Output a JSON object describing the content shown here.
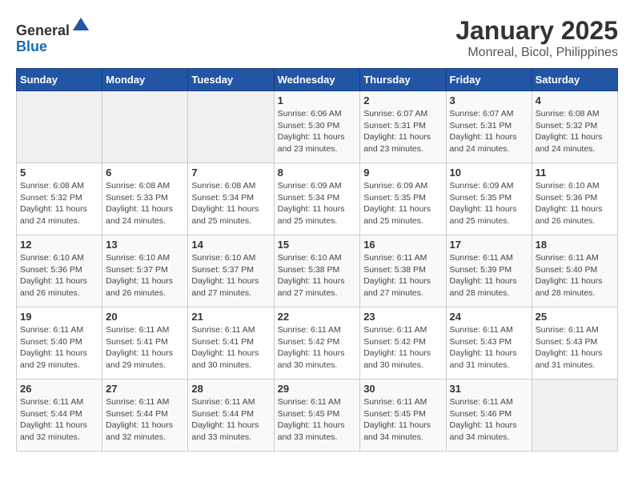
{
  "header": {
    "logo_line1": "General",
    "logo_line2": "Blue",
    "title": "January 2025",
    "subtitle": "Monreal, Bicol, Philippines"
  },
  "days_of_week": [
    "Sunday",
    "Monday",
    "Tuesday",
    "Wednesday",
    "Thursday",
    "Friday",
    "Saturday"
  ],
  "weeks": [
    [
      {
        "day": "",
        "info": ""
      },
      {
        "day": "",
        "info": ""
      },
      {
        "day": "",
        "info": ""
      },
      {
        "day": "1",
        "info": "Sunrise: 6:06 AM\nSunset: 5:30 PM\nDaylight: 11 hours\nand 23 minutes."
      },
      {
        "day": "2",
        "info": "Sunrise: 6:07 AM\nSunset: 5:31 PM\nDaylight: 11 hours\nand 23 minutes."
      },
      {
        "day": "3",
        "info": "Sunrise: 6:07 AM\nSunset: 5:31 PM\nDaylight: 11 hours\nand 24 minutes."
      },
      {
        "day": "4",
        "info": "Sunrise: 6:08 AM\nSunset: 5:32 PM\nDaylight: 11 hours\nand 24 minutes."
      }
    ],
    [
      {
        "day": "5",
        "info": "Sunrise: 6:08 AM\nSunset: 5:32 PM\nDaylight: 11 hours\nand 24 minutes."
      },
      {
        "day": "6",
        "info": "Sunrise: 6:08 AM\nSunset: 5:33 PM\nDaylight: 11 hours\nand 24 minutes."
      },
      {
        "day": "7",
        "info": "Sunrise: 6:08 AM\nSunset: 5:34 PM\nDaylight: 11 hours\nand 25 minutes."
      },
      {
        "day": "8",
        "info": "Sunrise: 6:09 AM\nSunset: 5:34 PM\nDaylight: 11 hours\nand 25 minutes."
      },
      {
        "day": "9",
        "info": "Sunrise: 6:09 AM\nSunset: 5:35 PM\nDaylight: 11 hours\nand 25 minutes."
      },
      {
        "day": "10",
        "info": "Sunrise: 6:09 AM\nSunset: 5:35 PM\nDaylight: 11 hours\nand 25 minutes."
      },
      {
        "day": "11",
        "info": "Sunrise: 6:10 AM\nSunset: 5:36 PM\nDaylight: 11 hours\nand 26 minutes."
      }
    ],
    [
      {
        "day": "12",
        "info": "Sunrise: 6:10 AM\nSunset: 5:36 PM\nDaylight: 11 hours\nand 26 minutes."
      },
      {
        "day": "13",
        "info": "Sunrise: 6:10 AM\nSunset: 5:37 PM\nDaylight: 11 hours\nand 26 minutes."
      },
      {
        "day": "14",
        "info": "Sunrise: 6:10 AM\nSunset: 5:37 PM\nDaylight: 11 hours\nand 27 minutes."
      },
      {
        "day": "15",
        "info": "Sunrise: 6:10 AM\nSunset: 5:38 PM\nDaylight: 11 hours\nand 27 minutes."
      },
      {
        "day": "16",
        "info": "Sunrise: 6:11 AM\nSunset: 5:38 PM\nDaylight: 11 hours\nand 27 minutes."
      },
      {
        "day": "17",
        "info": "Sunrise: 6:11 AM\nSunset: 5:39 PM\nDaylight: 11 hours\nand 28 minutes."
      },
      {
        "day": "18",
        "info": "Sunrise: 6:11 AM\nSunset: 5:40 PM\nDaylight: 11 hours\nand 28 minutes."
      }
    ],
    [
      {
        "day": "19",
        "info": "Sunrise: 6:11 AM\nSunset: 5:40 PM\nDaylight: 11 hours\nand 29 minutes."
      },
      {
        "day": "20",
        "info": "Sunrise: 6:11 AM\nSunset: 5:41 PM\nDaylight: 11 hours\nand 29 minutes."
      },
      {
        "day": "21",
        "info": "Sunrise: 6:11 AM\nSunset: 5:41 PM\nDaylight: 11 hours\nand 30 minutes."
      },
      {
        "day": "22",
        "info": "Sunrise: 6:11 AM\nSunset: 5:42 PM\nDaylight: 11 hours\nand 30 minutes."
      },
      {
        "day": "23",
        "info": "Sunrise: 6:11 AM\nSunset: 5:42 PM\nDaylight: 11 hours\nand 30 minutes."
      },
      {
        "day": "24",
        "info": "Sunrise: 6:11 AM\nSunset: 5:43 PM\nDaylight: 11 hours\nand 31 minutes."
      },
      {
        "day": "25",
        "info": "Sunrise: 6:11 AM\nSunset: 5:43 PM\nDaylight: 11 hours\nand 31 minutes."
      }
    ],
    [
      {
        "day": "26",
        "info": "Sunrise: 6:11 AM\nSunset: 5:44 PM\nDaylight: 11 hours\nand 32 minutes."
      },
      {
        "day": "27",
        "info": "Sunrise: 6:11 AM\nSunset: 5:44 PM\nDaylight: 11 hours\nand 32 minutes."
      },
      {
        "day": "28",
        "info": "Sunrise: 6:11 AM\nSunset: 5:44 PM\nDaylight: 11 hours\nand 33 minutes."
      },
      {
        "day": "29",
        "info": "Sunrise: 6:11 AM\nSunset: 5:45 PM\nDaylight: 11 hours\nand 33 minutes."
      },
      {
        "day": "30",
        "info": "Sunrise: 6:11 AM\nSunset: 5:45 PM\nDaylight: 11 hours\nand 34 minutes."
      },
      {
        "day": "31",
        "info": "Sunrise: 6:11 AM\nSunset: 5:46 PM\nDaylight: 11 hours\nand 34 minutes."
      },
      {
        "day": "",
        "info": ""
      }
    ]
  ]
}
